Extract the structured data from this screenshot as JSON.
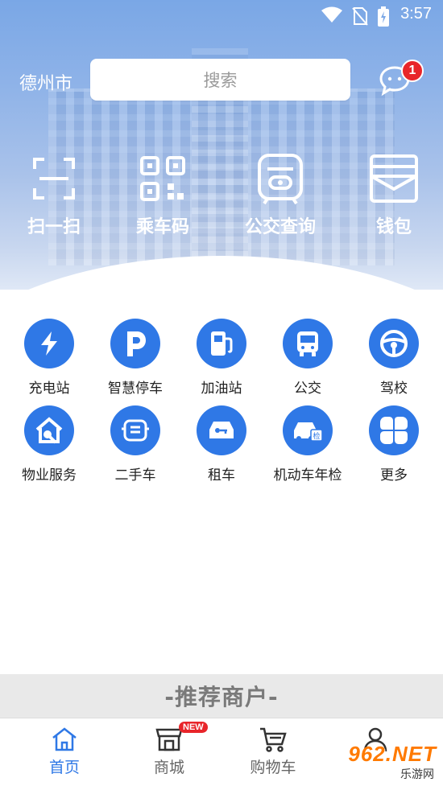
{
  "status_bar": {
    "time": "3:57"
  },
  "header": {
    "city": "德州市",
    "search_placeholder": "搜索",
    "message_badge": "1"
  },
  "quick_actions": [
    {
      "label": "扫一扫",
      "icon": "scan-icon"
    },
    {
      "label": "乘车码",
      "icon": "qr-code-icon"
    },
    {
      "label": "公交查询",
      "icon": "bus-card-icon"
    },
    {
      "label": "钱包",
      "icon": "wallet-icon"
    }
  ],
  "services": [
    {
      "label": "充电站",
      "icon": "lightning-icon"
    },
    {
      "label": "智慧停车",
      "icon": "parking-icon"
    },
    {
      "label": "加油站",
      "icon": "gas-station-icon"
    },
    {
      "label": "公交",
      "icon": "bus-icon"
    },
    {
      "label": "驾校",
      "icon": "steering-wheel-icon"
    },
    {
      "label": "物业服务",
      "icon": "property-service-icon"
    },
    {
      "label": "二手车",
      "icon": "used-car-icon"
    },
    {
      "label": "租车",
      "icon": "car-rental-icon"
    },
    {
      "label": "机动车年检",
      "icon": "car-inspection-icon"
    },
    {
      "label": "更多",
      "icon": "more-icon"
    }
  ],
  "recommend": {
    "title": "-推荐商户-"
  },
  "tabs": [
    {
      "label": "首页",
      "icon": "home-icon",
      "active": true
    },
    {
      "label": "商城",
      "icon": "shop-icon",
      "badge": "NEW"
    },
    {
      "label": "购物车",
      "icon": "cart-icon"
    },
    {
      "label": "",
      "icon": "profile-icon"
    }
  ],
  "watermark": {
    "brand": "962.NET",
    "sub": "乐游网"
  },
  "colors": {
    "accent": "#2f78e6",
    "badge": "#e8252a"
  }
}
